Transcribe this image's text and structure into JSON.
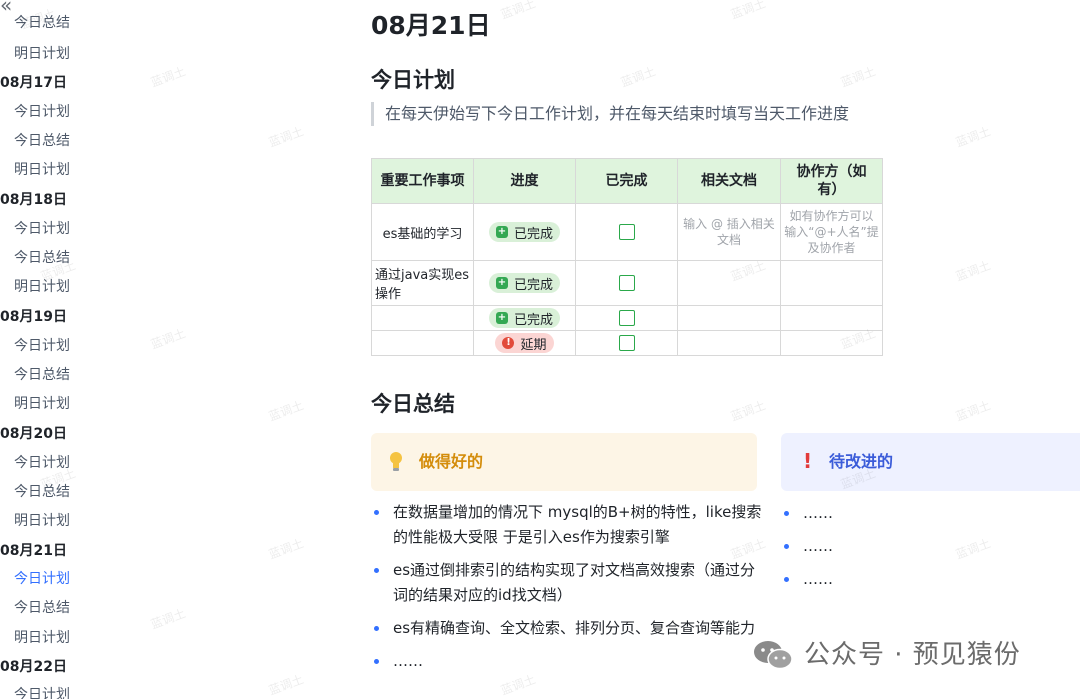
{
  "sidebar": {
    "collapse_label": "«",
    "top_items": [
      "今日总结",
      "明日计划"
    ],
    "groups": [
      {
        "date": "08月17日",
        "items": [
          "今日计划",
          "今日总结",
          "明日计划"
        ]
      },
      {
        "date": "08月18日",
        "items": [
          "今日计划",
          "今日总结",
          "明日计划"
        ]
      },
      {
        "date": "08月19日",
        "items": [
          "今日计划",
          "今日总结",
          "明日计划"
        ]
      },
      {
        "date": "08月20日",
        "items": [
          "今日计划",
          "今日总结",
          "明日计划"
        ]
      },
      {
        "date": "08月21日",
        "items": [
          "今日计划",
          "今日总结",
          "明日计划"
        ]
      },
      {
        "date": "08月22日",
        "items": [
          "今日计划"
        ]
      }
    ]
  },
  "page": {
    "title": "08月21日",
    "plan_heading": "今日计划",
    "plan_quote": "在每天伊始写下今日工作计划，并在每天结束时填写当天工作进度"
  },
  "plan_table": {
    "headers": [
      "重要工作事项",
      "进度",
      "已完成",
      "相关文档",
      "协作方（如有）"
    ],
    "rows": [
      {
        "task": "es基础的学习",
        "status": "已完成",
        "doc_hint": "输入 @ 插入相关文档",
        "collab_hint": "如有协作方可以输入“@+人名”提及协作者"
      },
      {
        "task": "通过java实现es操作",
        "status": "已完成",
        "doc_hint": "",
        "collab_hint": ""
      },
      {
        "task": "",
        "status": "已完成",
        "doc_hint": "",
        "collab_hint": ""
      },
      {
        "task": "",
        "status": "延期",
        "doc_hint": "",
        "collab_hint": ""
      }
    ]
  },
  "summary": {
    "heading": "今日总结",
    "good_title": "做得好的",
    "good_items": [
      "在数据量增加的情况下 mysql的B+树的特性，like搜索的性能极大受限 于是引入es作为搜索引擎",
      "es通过倒排索引的结构实现了对文档高效搜索（通过分词的结果对应的id找文档）",
      "es有精确查询、全文检索、排列分页、复合查询等能力",
      "……"
    ],
    "improve_title": "待改进的",
    "improve_items": [
      "……",
      "……",
      "……"
    ]
  },
  "watermark_text": "蓝调土",
  "wechat_badge": "公众号 · 预见猿份",
  "colors": {
    "accent": "#3370ff",
    "table_header": "#dff4dd",
    "good_callout": "#fdf5e6",
    "improve_callout": "#eef1ff"
  }
}
